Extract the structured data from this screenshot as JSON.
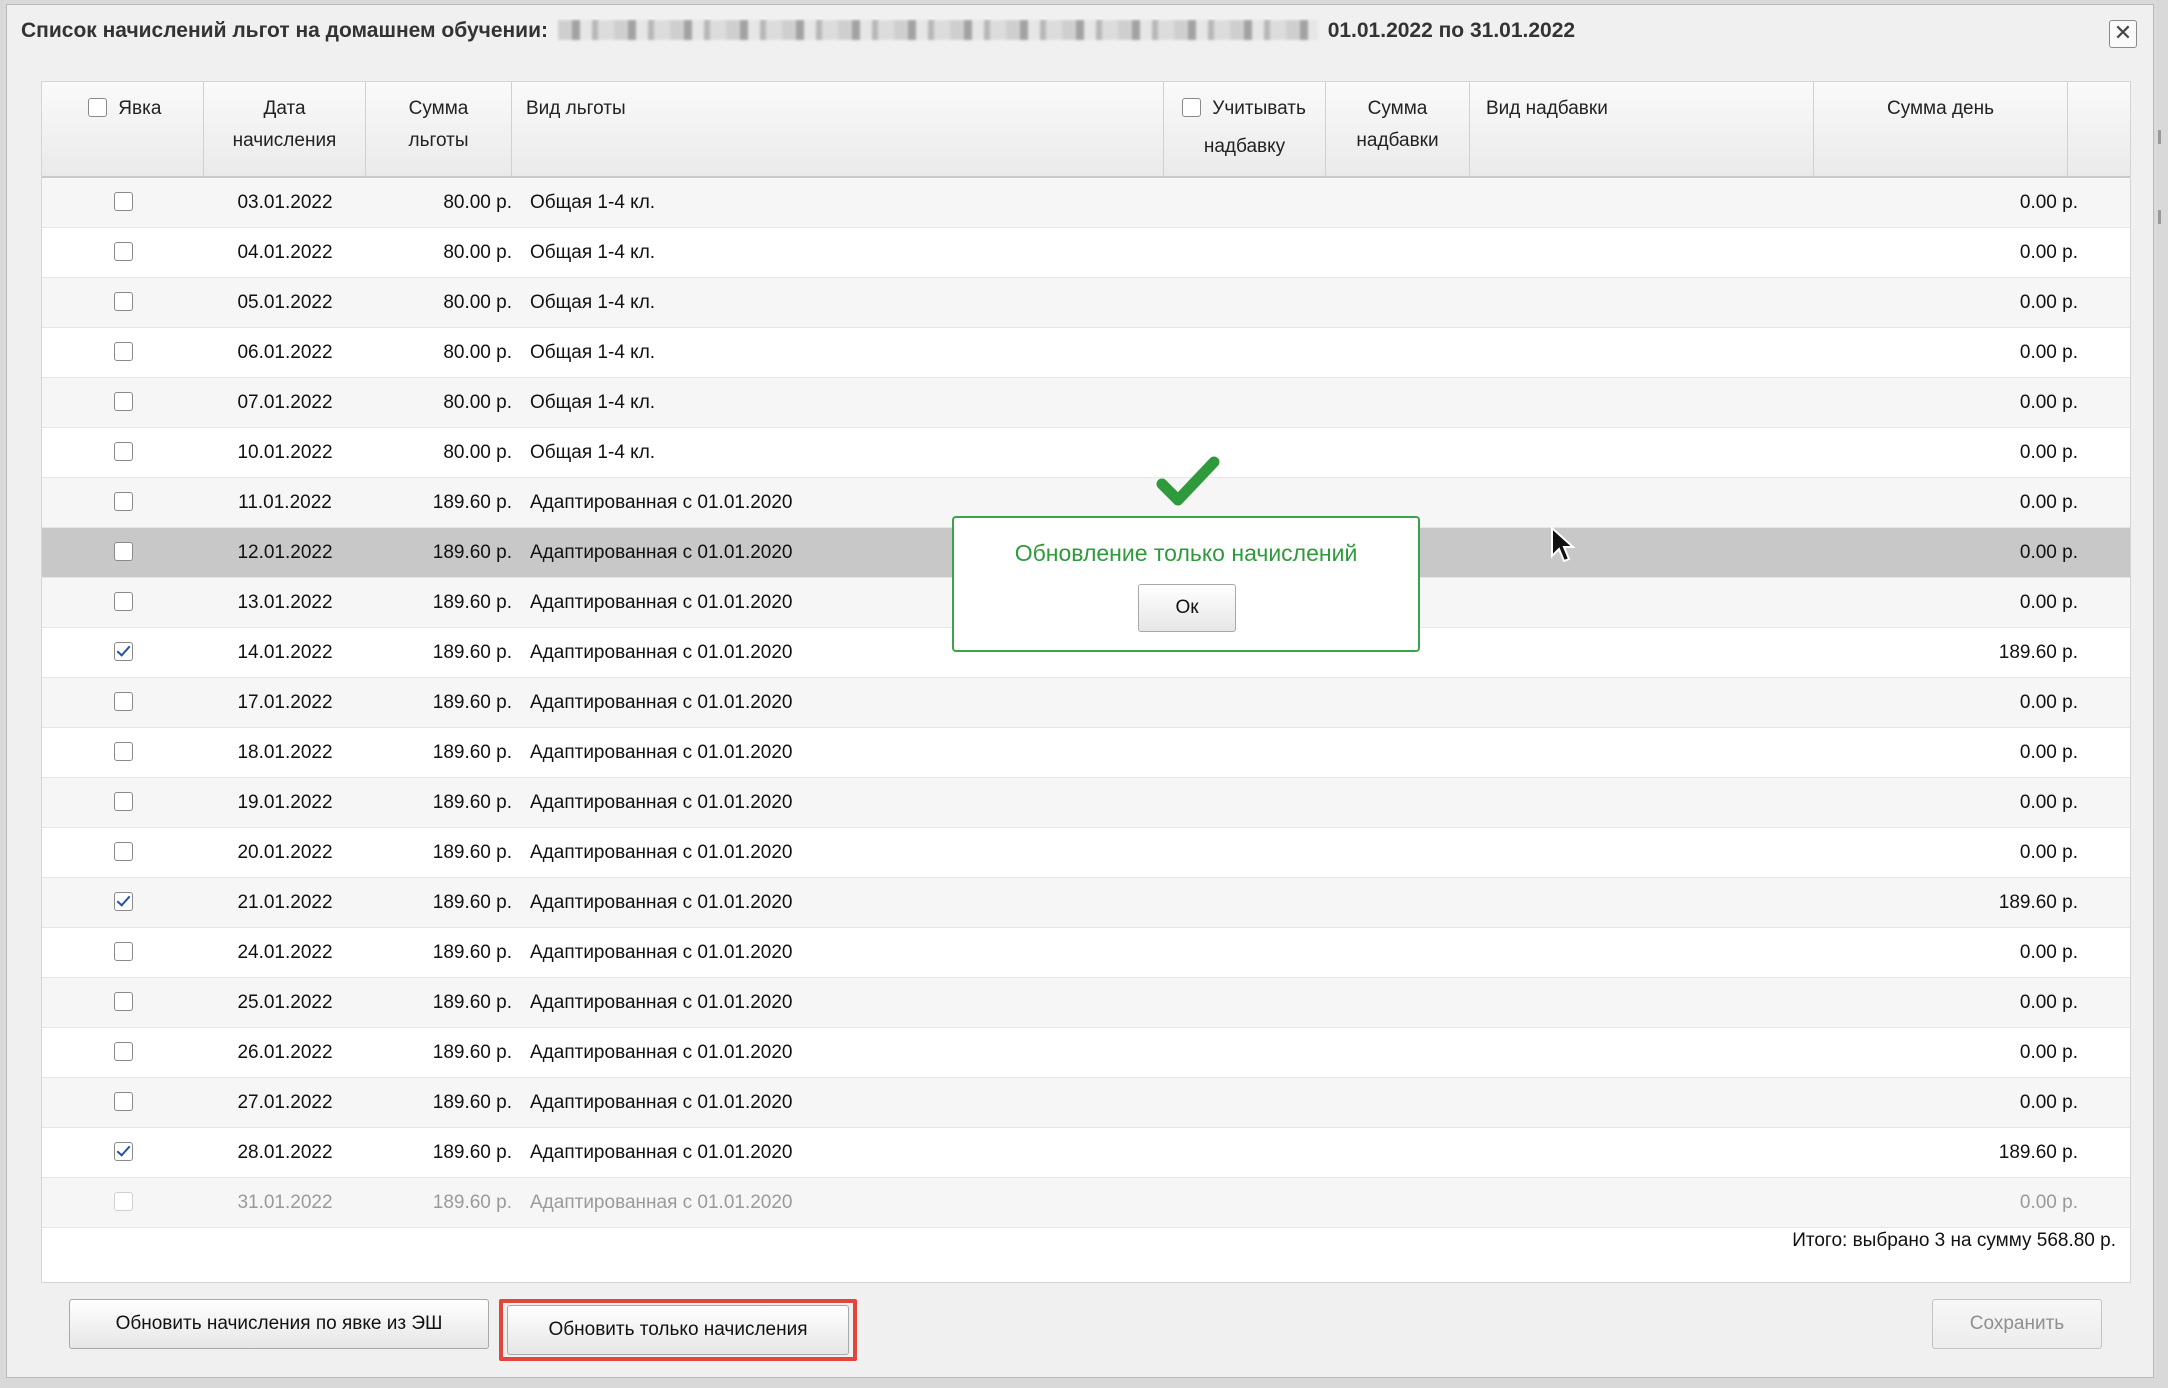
{
  "window": {
    "title_prefix": "Список начислений льгот на домашнем обучении:",
    "title_suffix": "01.01.2022 по 31.01.2022",
    "close_glyph": "✕"
  },
  "columns": {
    "attendance": "Явка",
    "date_l1": "Дата",
    "date_l2": "начисления",
    "sum_l1": "Сумма",
    "sum_l2": "льготы",
    "kind": "Вид льготы",
    "consider_l1": "Учитывать",
    "consider_l2": "надбавку",
    "bonus_sum_l1": "Сумма",
    "bonus_sum_l2": "надбавки",
    "bonus_kind": "Вид надбавки",
    "day_sum": "Сумма день"
  },
  "rows": [
    {
      "checked": false,
      "date": "03.01.2022",
      "sum": "80.00 р.",
      "kind": "Общая 1-4 кл.",
      "day": "0.00 р."
    },
    {
      "checked": false,
      "date": "04.01.2022",
      "sum": "80.00 р.",
      "kind": "Общая 1-4 кл.",
      "day": "0.00 р."
    },
    {
      "checked": false,
      "date": "05.01.2022",
      "sum": "80.00 р.",
      "kind": "Общая 1-4 кл.",
      "day": "0.00 р."
    },
    {
      "checked": false,
      "date": "06.01.2022",
      "sum": "80.00 р.",
      "kind": "Общая 1-4 кл.",
      "day": "0.00 р."
    },
    {
      "checked": false,
      "date": "07.01.2022",
      "sum": "80.00 р.",
      "kind": "Общая 1-4 кл.",
      "day": "0.00 р."
    },
    {
      "checked": false,
      "date": "10.01.2022",
      "sum": "80.00 р.",
      "kind": "Общая 1-4 кл.",
      "day": "0.00 р."
    },
    {
      "checked": false,
      "date": "11.01.2022",
      "sum": "189.60 р.",
      "kind": "Адаптированная с 01.01.2020",
      "day": "0.00 р."
    },
    {
      "checked": false,
      "date": "12.01.2022",
      "sum": "189.60 р.",
      "kind": "Адаптированная с 01.01.2020",
      "day": "0.00 р.",
      "highlight": true
    },
    {
      "checked": false,
      "date": "13.01.2022",
      "sum": "189.60 р.",
      "kind": "Адаптированная с 01.01.2020",
      "day": "0.00 р."
    },
    {
      "checked": true,
      "date": "14.01.2022",
      "sum": "189.60 р.",
      "kind": "Адаптированная с 01.01.2020",
      "day": "189.60 р."
    },
    {
      "checked": false,
      "date": "17.01.2022",
      "sum": "189.60 р.",
      "kind": "Адаптированная с 01.01.2020",
      "day": "0.00 р."
    },
    {
      "checked": false,
      "date": "18.01.2022",
      "sum": "189.60 р.",
      "kind": "Адаптированная с 01.01.2020",
      "day": "0.00 р."
    },
    {
      "checked": false,
      "date": "19.01.2022",
      "sum": "189.60 р.",
      "kind": "Адаптированная с 01.01.2020",
      "day": "0.00 р."
    },
    {
      "checked": false,
      "date": "20.01.2022",
      "sum": "189.60 р.",
      "kind": "Адаптированная с 01.01.2020",
      "day": "0.00 р."
    },
    {
      "checked": true,
      "date": "21.01.2022",
      "sum": "189.60 р.",
      "kind": "Адаптированная с 01.01.2020",
      "day": "189.60 р."
    },
    {
      "checked": false,
      "date": "24.01.2022",
      "sum": "189.60 р.",
      "kind": "Адаптированная с 01.01.2020",
      "day": "0.00 р."
    },
    {
      "checked": false,
      "date": "25.01.2022",
      "sum": "189.60 р.",
      "kind": "Адаптированная с 01.01.2020",
      "day": "0.00 р."
    },
    {
      "checked": false,
      "date": "26.01.2022",
      "sum": "189.60 р.",
      "kind": "Адаптированная с 01.01.2020",
      "day": "0.00 р."
    },
    {
      "checked": false,
      "date": "27.01.2022",
      "sum": "189.60 р.",
      "kind": "Адаптированная с 01.01.2020",
      "day": "0.00 р."
    },
    {
      "checked": true,
      "date": "28.01.2022",
      "sum": "189.60 р.",
      "kind": "Адаптированная с 01.01.2020",
      "day": "189.60 р."
    },
    {
      "checked": false,
      "date": "31.01.2022",
      "sum": "189.60 р.",
      "kind": "Адаптированная с 01.01.2020",
      "day": "0.00 р.",
      "disabled": true
    }
  ],
  "summary": "Итого: выбрано 3 на сумму 568.80 р.",
  "buttons": {
    "update_from_esh": "Обновить начисления по явке из ЭШ",
    "update_only": "Обновить только начисления",
    "save": "Сохранить"
  },
  "popup": {
    "message": "Обновление только начислений",
    "ok": "Ок"
  },
  "colors": {
    "success": "#2f9a3c",
    "annotation": "#e2453a",
    "checkbox_tick": "#2b4fa8"
  }
}
